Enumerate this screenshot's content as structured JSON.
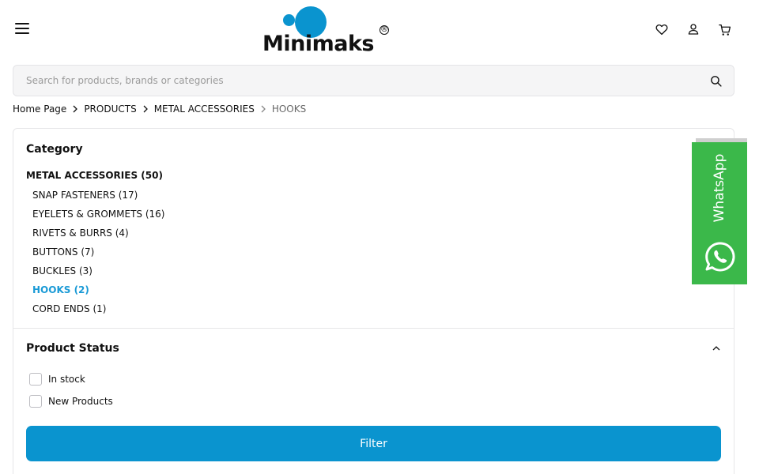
{
  "brand": {
    "name": "Minimaks",
    "registered": "®",
    "color": "#0a94cf"
  },
  "header": {
    "menu_icon": "hamburger-icon",
    "icons": [
      "heart-icon",
      "user-icon",
      "cart-icon"
    ]
  },
  "search": {
    "placeholder": "Search for products, brands or categories",
    "value": ""
  },
  "breadcrumb": {
    "items": [
      "Home Page",
      "PRODUCTS",
      "METAL ACCESSORIES"
    ],
    "current": "HOOKS"
  },
  "category": {
    "title": "Category",
    "parent": "METAL ACCESSORIES (50)",
    "items": [
      "SNAP FASTENERS (17)",
      "EYELETS & GROMMETS (16)",
      "RIVETS & BURRS (4)",
      "BUTTONS (7)",
      "BUCKLES (3)",
      "HOOKS (2)",
      "CORD ENDS (1)"
    ],
    "active_index": 5,
    "active_color": "#1a9ad6"
  },
  "product_status": {
    "title": "Product Status",
    "options": [
      "In stock",
      "New Products"
    ]
  },
  "filter": {
    "label": "Filter",
    "color": "#0a94cf"
  },
  "whatsapp": {
    "label": "WhatsApp",
    "color": "#3bb84a"
  }
}
